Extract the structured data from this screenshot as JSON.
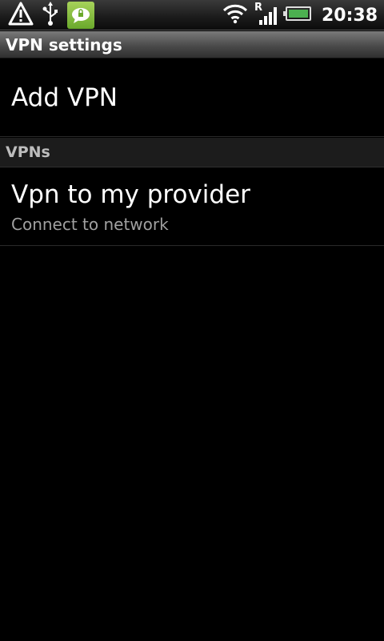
{
  "status_bar": {
    "time": "20:38",
    "icons": [
      "warning-icon",
      "usb-icon",
      "message-icon",
      "wifi-icon",
      "roaming-signal-icon",
      "battery-icon"
    ],
    "roaming_letter": "R",
    "accent_colors": {
      "message_notification": "#8bc34a",
      "battery_fill": "#4caf50"
    }
  },
  "title_bar": {
    "title": "VPN settings"
  },
  "add_vpn": {
    "label": "Add VPN"
  },
  "vpns_section": {
    "header": "VPNs",
    "items": [
      {
        "name": "Vpn to my provider",
        "summary": "Connect to network"
      }
    ]
  }
}
